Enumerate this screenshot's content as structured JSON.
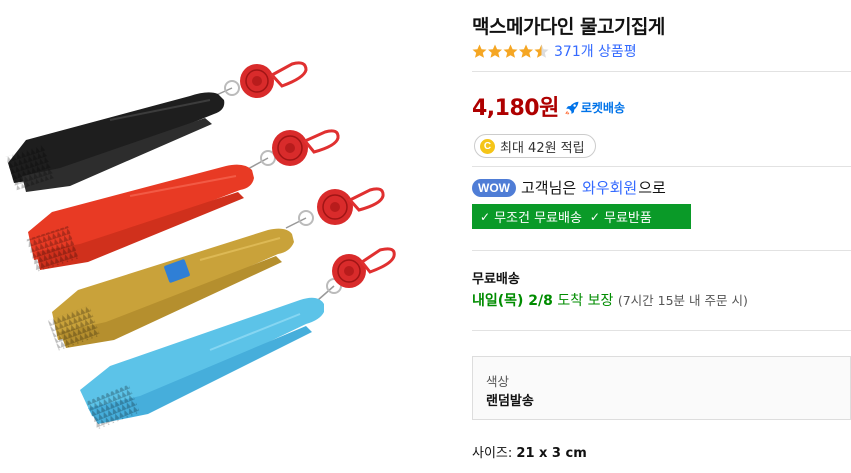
{
  "product": {
    "title": "맥스메가다인 물고기집게",
    "rating_value": 4.5,
    "rating_count": "371개 상품평",
    "price": "4,180원",
    "rocket_label": "로켓배송",
    "cash_icon": "C",
    "cash_text": "최대 42원 적립",
    "wow_badge": "WOW",
    "wow_prefix": "고객님은",
    "wow_member": "와우회원",
    "wow_suffix": "으로",
    "benefits": [
      "무조건 무료배송",
      "무료반품"
    ],
    "shipping_label": "무료배송",
    "delivery_date": "내일(목) 2/8",
    "delivery_word": "도착 보장",
    "delivery_note": "(7시간 15분 내 주문 시)",
    "option_label": "색상",
    "option_value": "랜덤발송",
    "spec_label": "사이즈:",
    "spec_value": "21 x 3 cm"
  },
  "colors": {
    "price": "#ae0000",
    "link": "#346aff",
    "rocket": "#0073e9",
    "benefit_bg": "#0a9a28",
    "delivery": "#008c00",
    "star": "#f5a623"
  },
  "image": {
    "tongs": [
      "black",
      "red",
      "gold",
      "sky-blue"
    ]
  }
}
